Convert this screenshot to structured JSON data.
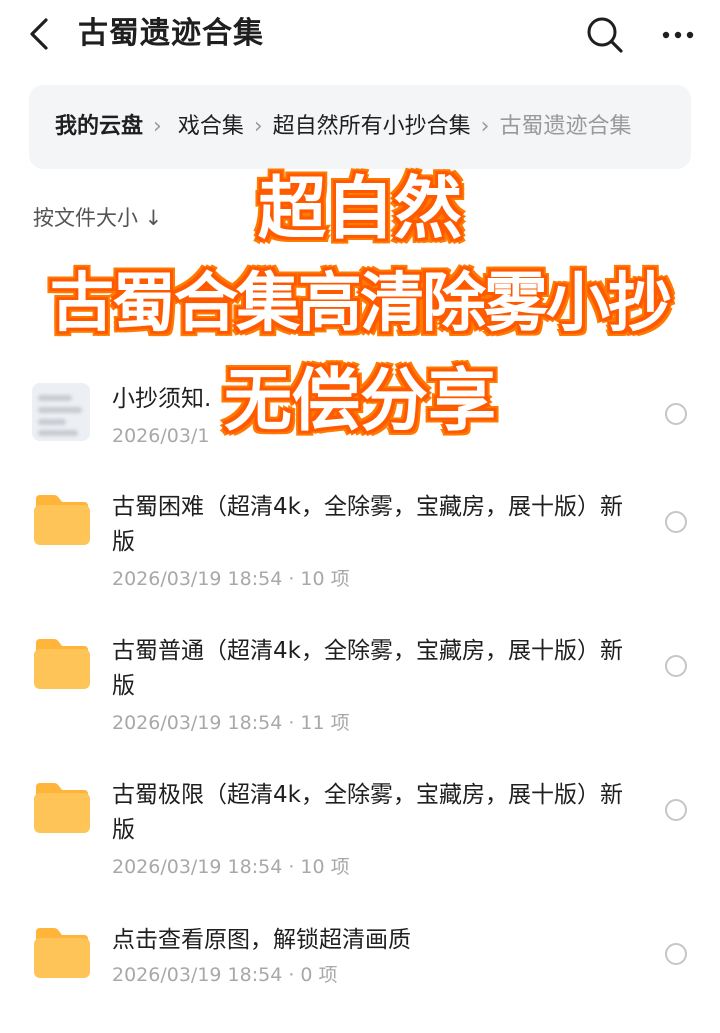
{
  "header": {
    "title": "古蜀遗迹合集",
    "back_icon": "chevron-left-icon",
    "search_icon": "search-icon",
    "more_icon": "more-horizontal-icon"
  },
  "breadcrumb": {
    "items": [
      "我的云盘",
      "戏合集",
      "超自然所有小抄合集",
      "古蜀遗迹合集"
    ],
    "separator": "›"
  },
  "sort": {
    "label": "按文件大小 ↓"
  },
  "files": [
    {
      "name": "小抄须知.",
      "meta": "2026/03/1",
      "type": "image"
    },
    {
      "name": "古蜀困难（超清4k，全除雾，宝藏房，展十版）新版",
      "meta": "2026/03/19 18:54 · 10 项",
      "type": "folder"
    },
    {
      "name": "古蜀普通（超清4k，全除雾，宝藏房，展十版）新版",
      "meta": "2026/03/19 18:54 · 11 项",
      "type": "folder"
    },
    {
      "name": "古蜀极限（超清4k，全除雾，宝藏房，展十版）新版",
      "meta": "2026/03/19 18:54 · 10 项",
      "type": "folder"
    },
    {
      "name": "点击查看原图，解锁超清画质",
      "meta": "2026/03/19 18:54 · 0 项",
      "type": "folder"
    }
  ],
  "overlay": {
    "line1": "超自然",
    "line2": "古蜀合集高清除雾小抄",
    "line3": "无偿分享",
    "stroke_color": "#ff5a00"
  },
  "colors": {
    "folder": "#ffc457",
    "folder_tab": "#ffb53a",
    "breadcrumb_bg": "#f4f5f7",
    "meta_text": "#a8a8a8"
  }
}
